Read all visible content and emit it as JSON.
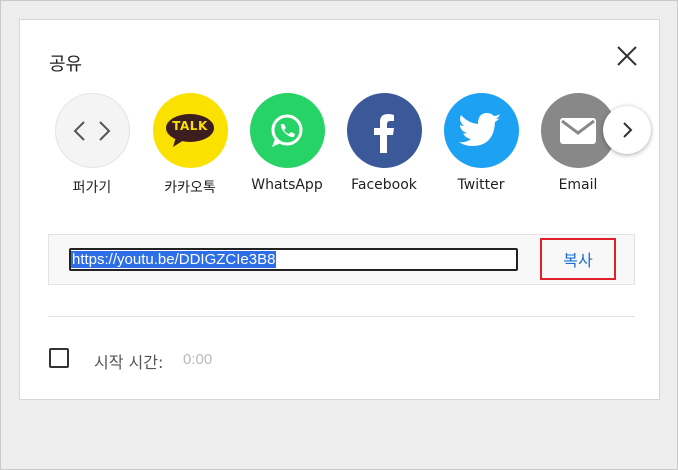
{
  "dialog": {
    "title": "공유",
    "close_icon": "close-icon"
  },
  "share_targets": [
    {
      "label": "퍼가기",
      "icon": "embed-icon",
      "color": "#f4f4f4"
    },
    {
      "label": "카카오톡",
      "icon": "kakaotalk-icon",
      "icon_text": "TALK",
      "color": "#fae100"
    },
    {
      "label": "WhatsApp",
      "icon": "whatsapp-icon",
      "color": "#25d366"
    },
    {
      "label": "Facebook",
      "icon": "facebook-icon",
      "color": "#3b5998"
    },
    {
      "label": "Twitter",
      "icon": "twitter-icon",
      "color": "#1da1f2"
    },
    {
      "label": "Email",
      "icon": "email-icon",
      "color": "#888888"
    }
  ],
  "next_icon": "chevron-right-icon",
  "link": {
    "url": "https://youtu.be/DDIGZCIe3B8",
    "copy_label": "복사"
  },
  "start_time": {
    "label": "시작 시간:",
    "value": "0:00",
    "checked": false
  },
  "colors": {
    "highlight": "#e0202a",
    "link_blue": "#1a6fd1",
    "selection": "#2e6ee6"
  }
}
